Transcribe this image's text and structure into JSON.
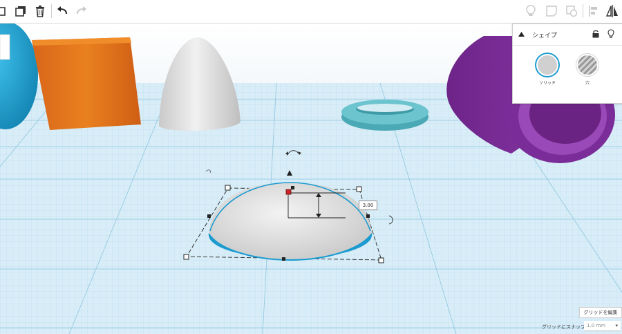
{
  "toolbar": {
    "left_icons": [
      "group-icon",
      "duplicate-icon",
      "delete-icon",
      "undo-icon",
      "redo-icon"
    ],
    "right_icons": [
      "lightbulb-icon",
      "note-icon",
      "hide-icon",
      "align-icon",
      "mirror-icon"
    ]
  },
  "shape_panel": {
    "title": "シェイプ",
    "solid_label": "ソリッド",
    "hole_label": "穴"
  },
  "viewport": {
    "dimension_value": "3.00"
  },
  "grid_controls": {
    "edit_grid_label": "グリッドを編集",
    "snap_label": "グリッドにスナップ",
    "snap_value": "1.0 mm"
  },
  "colors": {
    "grid_bg": "#d8edf7",
    "grid_line": "#9fcde4",
    "sphere": "#1a9fd0",
    "box": "#e4761f",
    "paraboloid": "#e2e2e2",
    "torus": "#5bb8c3",
    "tube": "#7b2d98",
    "selection": "#222222",
    "accent": "#1b9bd0"
  }
}
